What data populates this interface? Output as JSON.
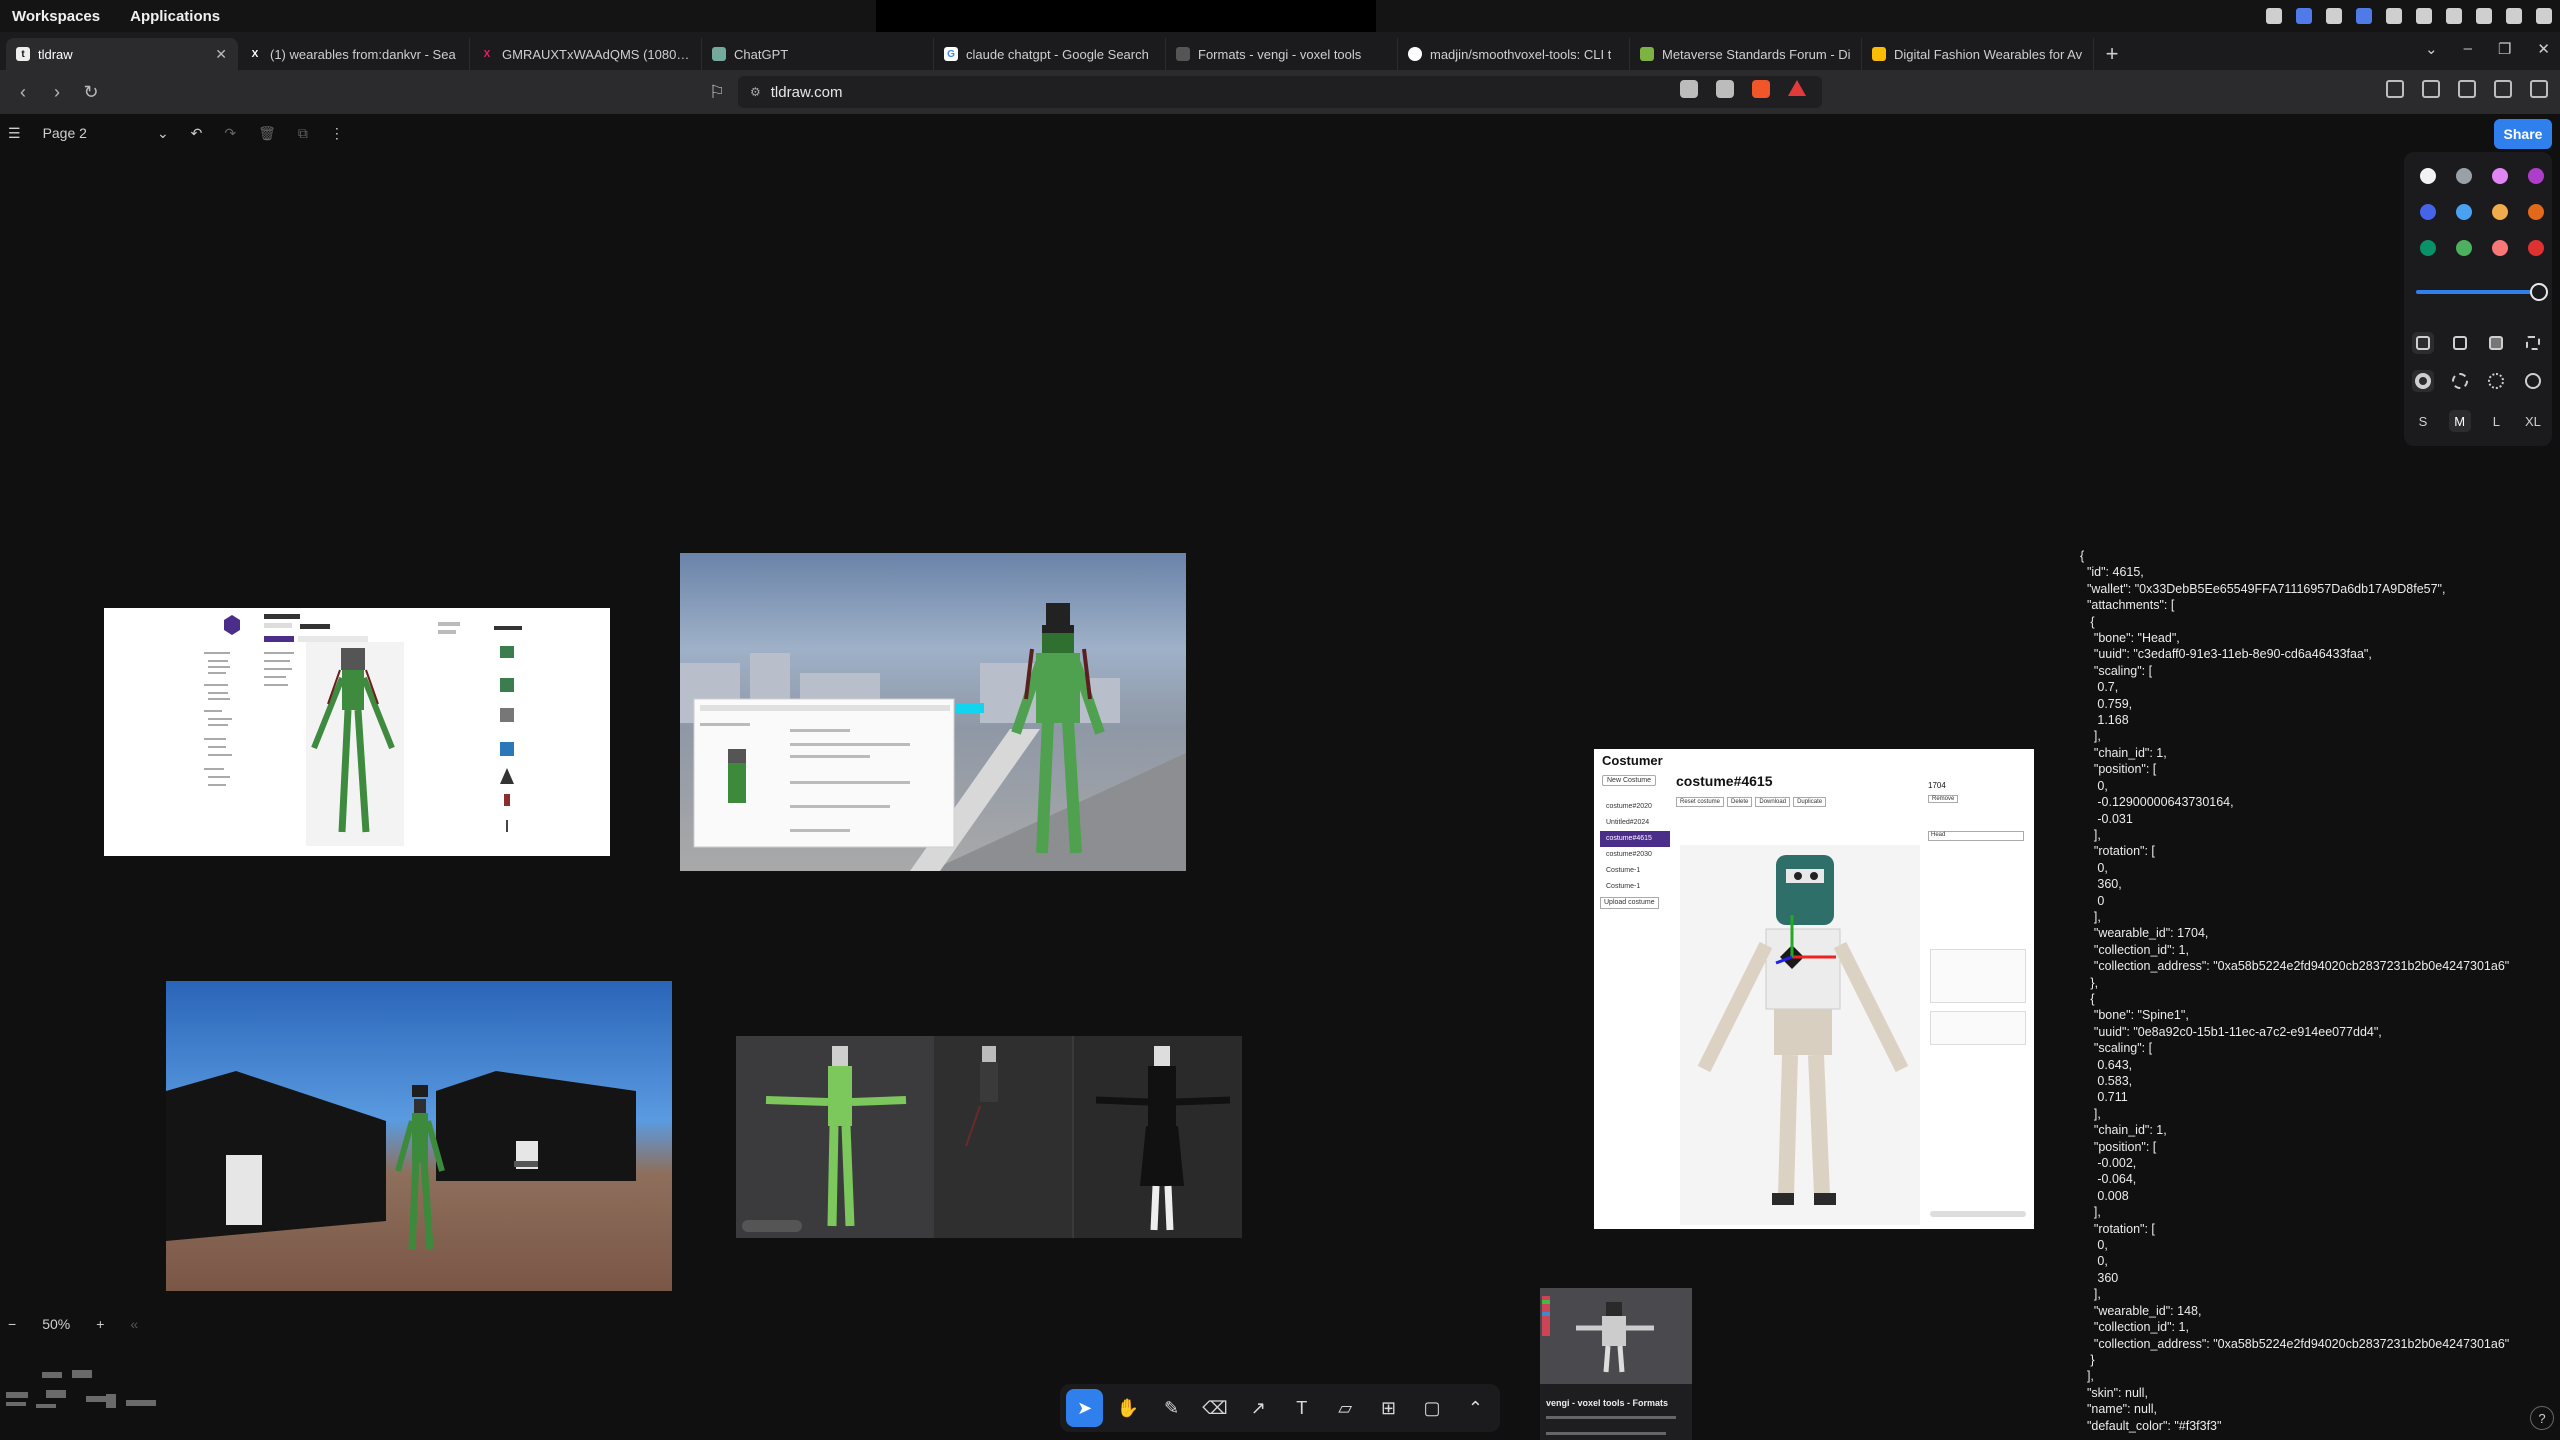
{
  "system": {
    "workspaces": "Workspaces",
    "applications": "Applications"
  },
  "tabs": [
    {
      "title": "tldraw",
      "icon": "tldraw-icon"
    },
    {
      "title": "(1) wearables from:dankvr - Sea",
      "icon": "x-icon"
    },
    {
      "title": "GMRAUXTxWAAdQMS (1080×608)",
      "icon": "x-icon"
    },
    {
      "title": "ChatGPT",
      "icon": "chatgpt-icon"
    },
    {
      "title": "claude chatgpt - Google Search",
      "icon": "google-icon"
    },
    {
      "title": "Formats - vengi - voxel tools",
      "icon": "vengi-icon"
    },
    {
      "title": "madjin/smoothvoxel-tools: CLI t",
      "icon": "github-icon"
    },
    {
      "title": "Metaverse Standards Forum - Di",
      "icon": "msf-icon"
    },
    {
      "title": "Digital Fashion Wearables for Av",
      "icon": "drive-icon"
    }
  ],
  "url": "tldraw.com",
  "editor": {
    "page_name": "Page 2",
    "share_label": "Share",
    "zoom_level": "50%",
    "sizes": [
      "S",
      "M",
      "L",
      "XL"
    ],
    "selected_size": "M",
    "colors": [
      "#f2f2f2",
      "#9aa0aa",
      "#e085f4",
      "#ae3ec9",
      "#4465e9",
      "#4ba1f1",
      "#f1ac4b",
      "#e16919",
      "#099268",
      "#4cb05e",
      "#f87777",
      "#e03131"
    ]
  },
  "costumer_card": {
    "app_title": "Costumer",
    "costume_title": "costume#4615",
    "wallet_id": "1704",
    "new_costume": "New Costume",
    "actions": [
      "Reset costume",
      "Delete",
      "Download",
      "Duplicate"
    ],
    "list": [
      "costume#2020",
      "Untitled#2024",
      "costume#4615",
      "costume#2030",
      "Costume-1",
      "Costume-1"
    ],
    "upload": "Upload costume",
    "remove": "Remove",
    "bone_select": "Head"
  },
  "vengi_card": {
    "title": "vengi - voxel tools - Formats"
  },
  "json_lines": [
    "{",
    "  \"id\": 4615,",
    "  \"wallet\": \"0x33DebB5Ee65549FFA71116957Da6db17A9D8fe57\",",
    "  \"attachments\": [",
    "   {",
    "    \"bone\": \"Head\",",
    "    \"uuid\": \"c3edaff0-91e3-11eb-8e90-cd6a46433faa\",",
    "    \"scaling\": [",
    "     0.7,",
    "     0.759,",
    "     1.168",
    "    ],",
    "    \"chain_id\": 1,",
    "    \"position\": [",
    "     0,",
    "     -0.12900000643730164,",
    "     -0.031",
    "    ],",
    "    \"rotation\": [",
    "     0,",
    "     360,",
    "     0",
    "    ],",
    "    \"wearable_id\": 1704,",
    "    \"collection_id\": 1,",
    "    \"collection_address\": \"0xa58b5224e2fd94020cb2837231b2b0e4247301a6\"",
    "   },",
    "   {",
    "    \"bone\": \"Spine1\",",
    "    \"uuid\": \"0e8a92c0-15b1-11ec-a7c2-e914ee077dd4\",",
    "    \"scaling\": [",
    "     0.643,",
    "     0.583,",
    "     0.711",
    "    ],",
    "    \"chain_id\": 1,",
    "    \"position\": [",
    "     -0.002,",
    "     -0.064,",
    "     0.008",
    "    ],",
    "    \"rotation\": [",
    "     0,",
    "     0,",
    "     360",
    "    ],",
    "    \"wearable_id\": 148,",
    "    \"collection_id\": 1,",
    "    \"collection_address\": \"0xa58b5224e2fd94020cb2837231b2b0e4247301a6\"",
    "   }",
    "  ],",
    "  \"skin\": null,",
    "  \"name\": null,",
    "  \"default_color\": \"#f3f3f3\""
  ]
}
